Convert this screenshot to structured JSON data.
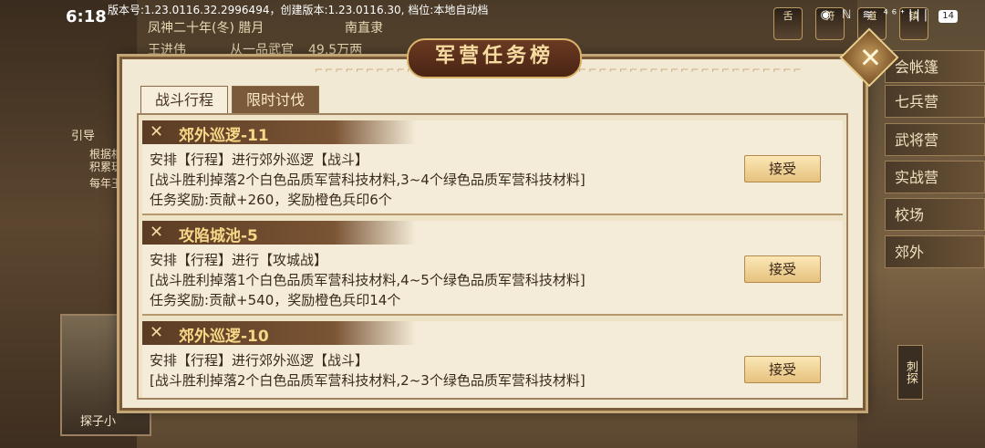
{
  "status_bar": {
    "time": "6:18",
    "version_text": "版本号:1.23.0116.32.2996494，创建版本:1.23.0116.30, 档位:本地自动档",
    "icons_text": "◉ ℕ ≋ ⁴⁶ᐩ|||",
    "battery": "14"
  },
  "background": {
    "date": "凤神二十年(冬) 腊月",
    "location": "南直隶",
    "name": "王进伟",
    "rank": "从一品武官",
    "money": "49.5万两",
    "guide_label": "引导",
    "guide_lines": [
      "根据相",
      "积累玩",
      "每年玉"
    ],
    "portrait_label": "探子小",
    "right_menu": [
      "会帐篷",
      "七兵营",
      "武将营",
      "实战营",
      "校场",
      "郊外"
    ],
    "top_controls": [
      "舌",
      "符",
      "道",
      "镇"
    ],
    "probe_label": "刺探"
  },
  "dialog": {
    "title": "军营任务榜",
    "close_label": "✕",
    "tabs": [
      {
        "label": "战斗行程",
        "active": true
      },
      {
        "label": "限时讨伐",
        "active": false
      }
    ],
    "quests": [
      {
        "title": "郊外巡逻-11",
        "line1": "安排【行程】进行郊外巡逻【战斗】",
        "line2": "[战斗胜利掉落2个白色品质军营科技材料,3~4个绿色品质军营科技材料]",
        "line3": "任务奖励:贡献+260，奖励橙色兵印6个",
        "button": "接受"
      },
      {
        "title": "攻陷城池-5",
        "line1": "安排【行程】进行【攻城战】",
        "line2": "[战斗胜利掉落1个白色品质军营科技材料,4~5个绿色品质军营科技材料]",
        "line3": "任务奖励:贡献+540，奖励橙色兵印14个",
        "button": "接受"
      },
      {
        "title": "郊外巡逻-10",
        "line1": "安排【行程】进行郊外巡逻【战斗】",
        "line2": "[战斗胜利掉落2个白色品质军营科技材料,2~3个绿色品质军营科技材料]",
        "line3": "",
        "button": "接受"
      }
    ]
  },
  "colors": {
    "dialog_bg": "#f2e9d4",
    "title_bg": "#4a2414",
    "quest_header": "#5b3c24",
    "accept_btn": "#e6c27e"
  }
}
